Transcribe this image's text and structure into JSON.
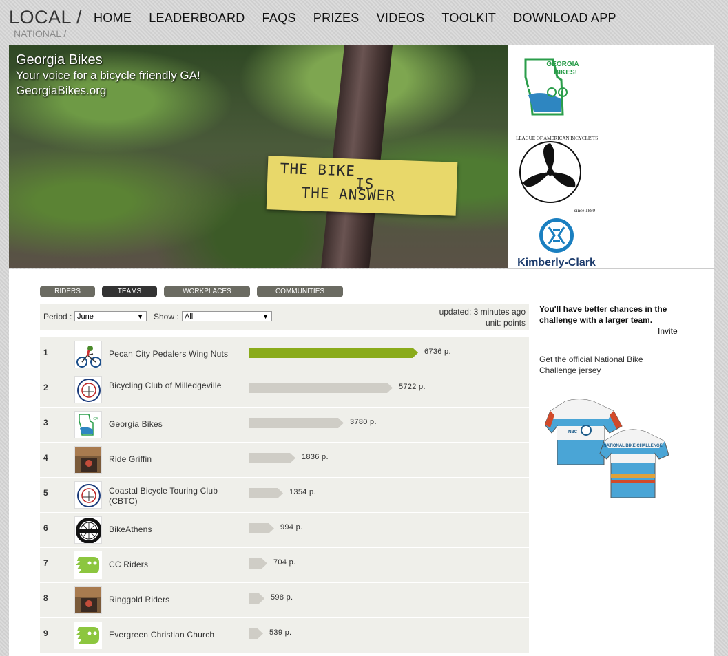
{
  "header": {
    "local": "LOCAL /",
    "national": "NATIONAL /",
    "nav": [
      "HOME",
      "LEADERBOARD",
      "FAQS",
      "PRIZES",
      "VIDEOS",
      "TOOLKIT",
      "DOWNLOAD APP"
    ]
  },
  "hero": {
    "title": "Georgia Bikes",
    "tagline": "Your voice for a bicycle friendly GA!",
    "url": "GeorgiaBikes.org",
    "sign_line1": "THE BIKE",
    "sign_line2": "IS",
    "sign_line3": "THE  ANSWER"
  },
  "sponsors": {
    "georgia_bikes_line1": "GEORGIA",
    "georgia_bikes_line2": "BIKES!",
    "league": "THE LEAGUE OF AMERICAN BICYCLISTS",
    "league_since": "since 1880",
    "kimberly_clark": "Kimberly-Clark"
  },
  "tabs": [
    {
      "label": "RIDERS",
      "active": false
    },
    {
      "label": "TEAMS",
      "active": true
    },
    {
      "label": "WORKPLACES",
      "active": false
    },
    {
      "label": "COMMUNITIES",
      "active": false
    }
  ],
  "filters": {
    "period_label": "Period :",
    "period_value": "June",
    "show_label": "Show :",
    "show_value": "All",
    "updated": "updated: 3 minutes ago",
    "unit": "unit: points"
  },
  "leaderboard": {
    "max_points": 6736,
    "rows": [
      {
        "rank": "1",
        "name": "Pecan City Pedalers Wing Nuts",
        "points": 6736,
        "points_label": "6736 p.",
        "highlight": true,
        "icon": "cyclist-logo-icon"
      },
      {
        "rank": "2",
        "name": "Bicycling Club of Milledgeville",
        "points": 5722,
        "points_label": "5722 p.",
        "highlight": false,
        "icon": "club-badge-icon"
      },
      {
        "rank": "3",
        "name": "Georgia Bikes",
        "points": 3780,
        "points_label": "3780 p.",
        "highlight": false,
        "icon": "georgia-bikes-icon"
      },
      {
        "rank": "4",
        "name": "Ride Griffin",
        "points": 1836,
        "points_label": "1836 p.",
        "highlight": false,
        "icon": "photo-icon"
      },
      {
        "rank": "5",
        "name": "Coastal Bicycle Touring Club (CBTC)",
        "points": 1354,
        "points_label": "1354 p.",
        "highlight": false,
        "icon": "cbtc-badge-icon"
      },
      {
        "rank": "6",
        "name": "BikeAthens",
        "points": 994,
        "points_label": "994 p.",
        "highlight": false,
        "icon": "bikeathens-wheel-icon"
      },
      {
        "rank": "7",
        "name": "CC Riders",
        "points": 704,
        "points_label": "704 p.",
        "highlight": false,
        "icon": "default-team-icon"
      },
      {
        "rank": "8",
        "name": "Ringgold Riders",
        "points": 598,
        "points_label": "598 p.",
        "highlight": false,
        "icon": "photo-icon"
      },
      {
        "rank": "9",
        "name": "Evergreen Christian Church",
        "points": 539,
        "points_label": "539 p.",
        "highlight": false,
        "icon": "default-team-icon"
      }
    ]
  },
  "sidebar": {
    "message": "You'll have better chances in the challenge with a larger team.",
    "invite": "Invite",
    "jersey_text": "Get the official National Bike Challenge jersey",
    "jersey_print": "NATIONAL BIKE CHALLENGE"
  },
  "colors": {
    "leader_bar": "#8aab1a",
    "other_bar": "#cfcdc6",
    "row_bg": "#efefea",
    "default_icon": "#8cc63f"
  }
}
